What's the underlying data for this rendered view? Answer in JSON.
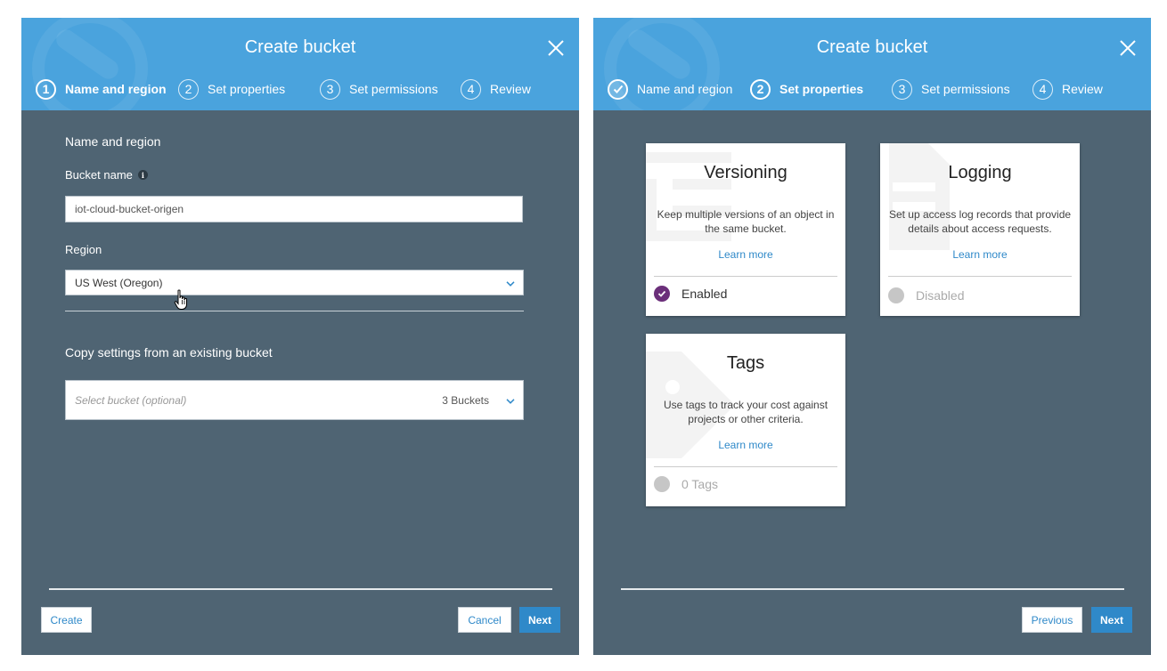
{
  "dialog1": {
    "title": "Create bucket",
    "steps": [
      {
        "num": "1",
        "label": "Name and region"
      },
      {
        "num": "2",
        "label": "Set properties"
      },
      {
        "num": "3",
        "label": "Set permissions"
      },
      {
        "num": "4",
        "label": "Review"
      }
    ],
    "section_title": "Name and region",
    "bucket_name_label": "Bucket name",
    "bucket_name_value": "iot-cloud-bucket-origen",
    "region_label": "Region",
    "region_value": "US West (Oregon)",
    "copy_title": "Copy settings from an existing bucket",
    "copy_placeholder": "Select bucket (optional)",
    "copy_count": "3 Buckets",
    "buttons": {
      "create": "Create",
      "cancel": "Cancel",
      "next": "Next"
    }
  },
  "dialog2": {
    "title": "Create bucket",
    "steps": [
      {
        "num": "1",
        "label": "Name and region"
      },
      {
        "num": "2",
        "label": "Set properties"
      },
      {
        "num": "3",
        "label": "Set permissions"
      },
      {
        "num": "4",
        "label": "Review"
      }
    ],
    "cards": {
      "versioning": {
        "title": "Versioning",
        "desc": "Keep multiple versions of an object in the same bucket.",
        "link": "Learn more",
        "status": "Enabled"
      },
      "logging": {
        "title": "Logging",
        "desc": "Set up access log records that provide details about access requests.",
        "link": "Learn more",
        "status": "Disabled"
      },
      "tags": {
        "title": "Tags",
        "desc": "Use tags to track your cost against projects or other criteria.",
        "link": "Learn more",
        "status": "0 Tags"
      }
    },
    "buttons": {
      "previous": "Previous",
      "next": "Next"
    }
  },
  "colors": {
    "header": "#4aa3dd",
    "body": "#4f6473",
    "accent": "#2f89c9",
    "enabled": "#6b2f7a"
  }
}
